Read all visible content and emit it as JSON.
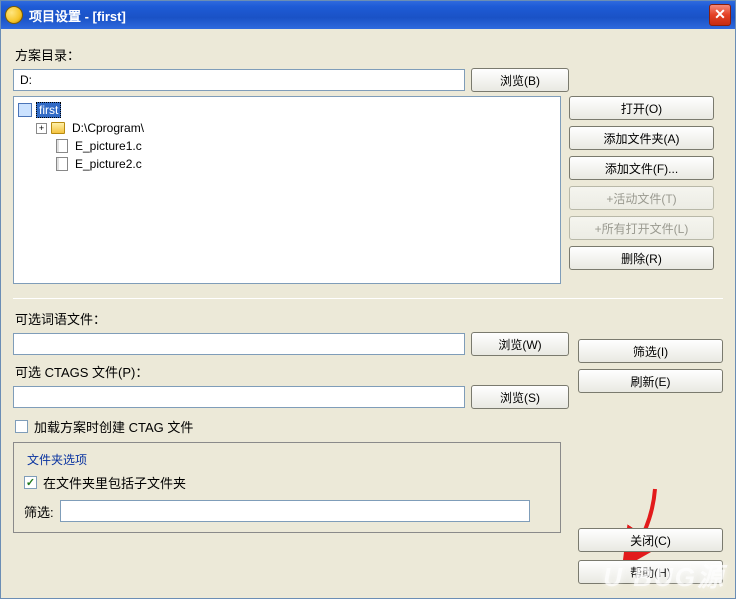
{
  "title": "项目设置 - [first]",
  "dir_label": "方案目录：",
  "dir_value": "D:",
  "browse": "浏览(B)",
  "tree": {
    "root": "first",
    "folder": "D:\\Cprogram\\",
    "file1": "E_picture1.c",
    "file2": "E_picture2.c"
  },
  "right": {
    "open": "打开(O)",
    "add_folder": "添加文件夹(A)",
    "add_file": "添加文件(F)...",
    "active_file": "+活动文件(T)",
    "all_open": "+所有打开文件(L)",
    "delete": "删除(R)",
    "filter": "筛选(I)",
    "refresh": "刷新(E)"
  },
  "opt_word_label": "可选词语文件：",
  "opt_word_value": "",
  "browse_w": "浏览(W)",
  "ctags_label": "可选 CTAGS 文件(P)：",
  "ctags_value": "",
  "browse_s": "浏览(S)",
  "ctag_checkbox": "加载方案时创建 CTAG 文件",
  "folder_opts_legend": "文件夹选项",
  "include_sub": "在文件夹里包括子文件夹",
  "filter_label": "筛选:",
  "filter_value": "",
  "close_btn": "关闭(C)",
  "help_btn": "帮助(H)",
  "watermark": "U BUG源"
}
